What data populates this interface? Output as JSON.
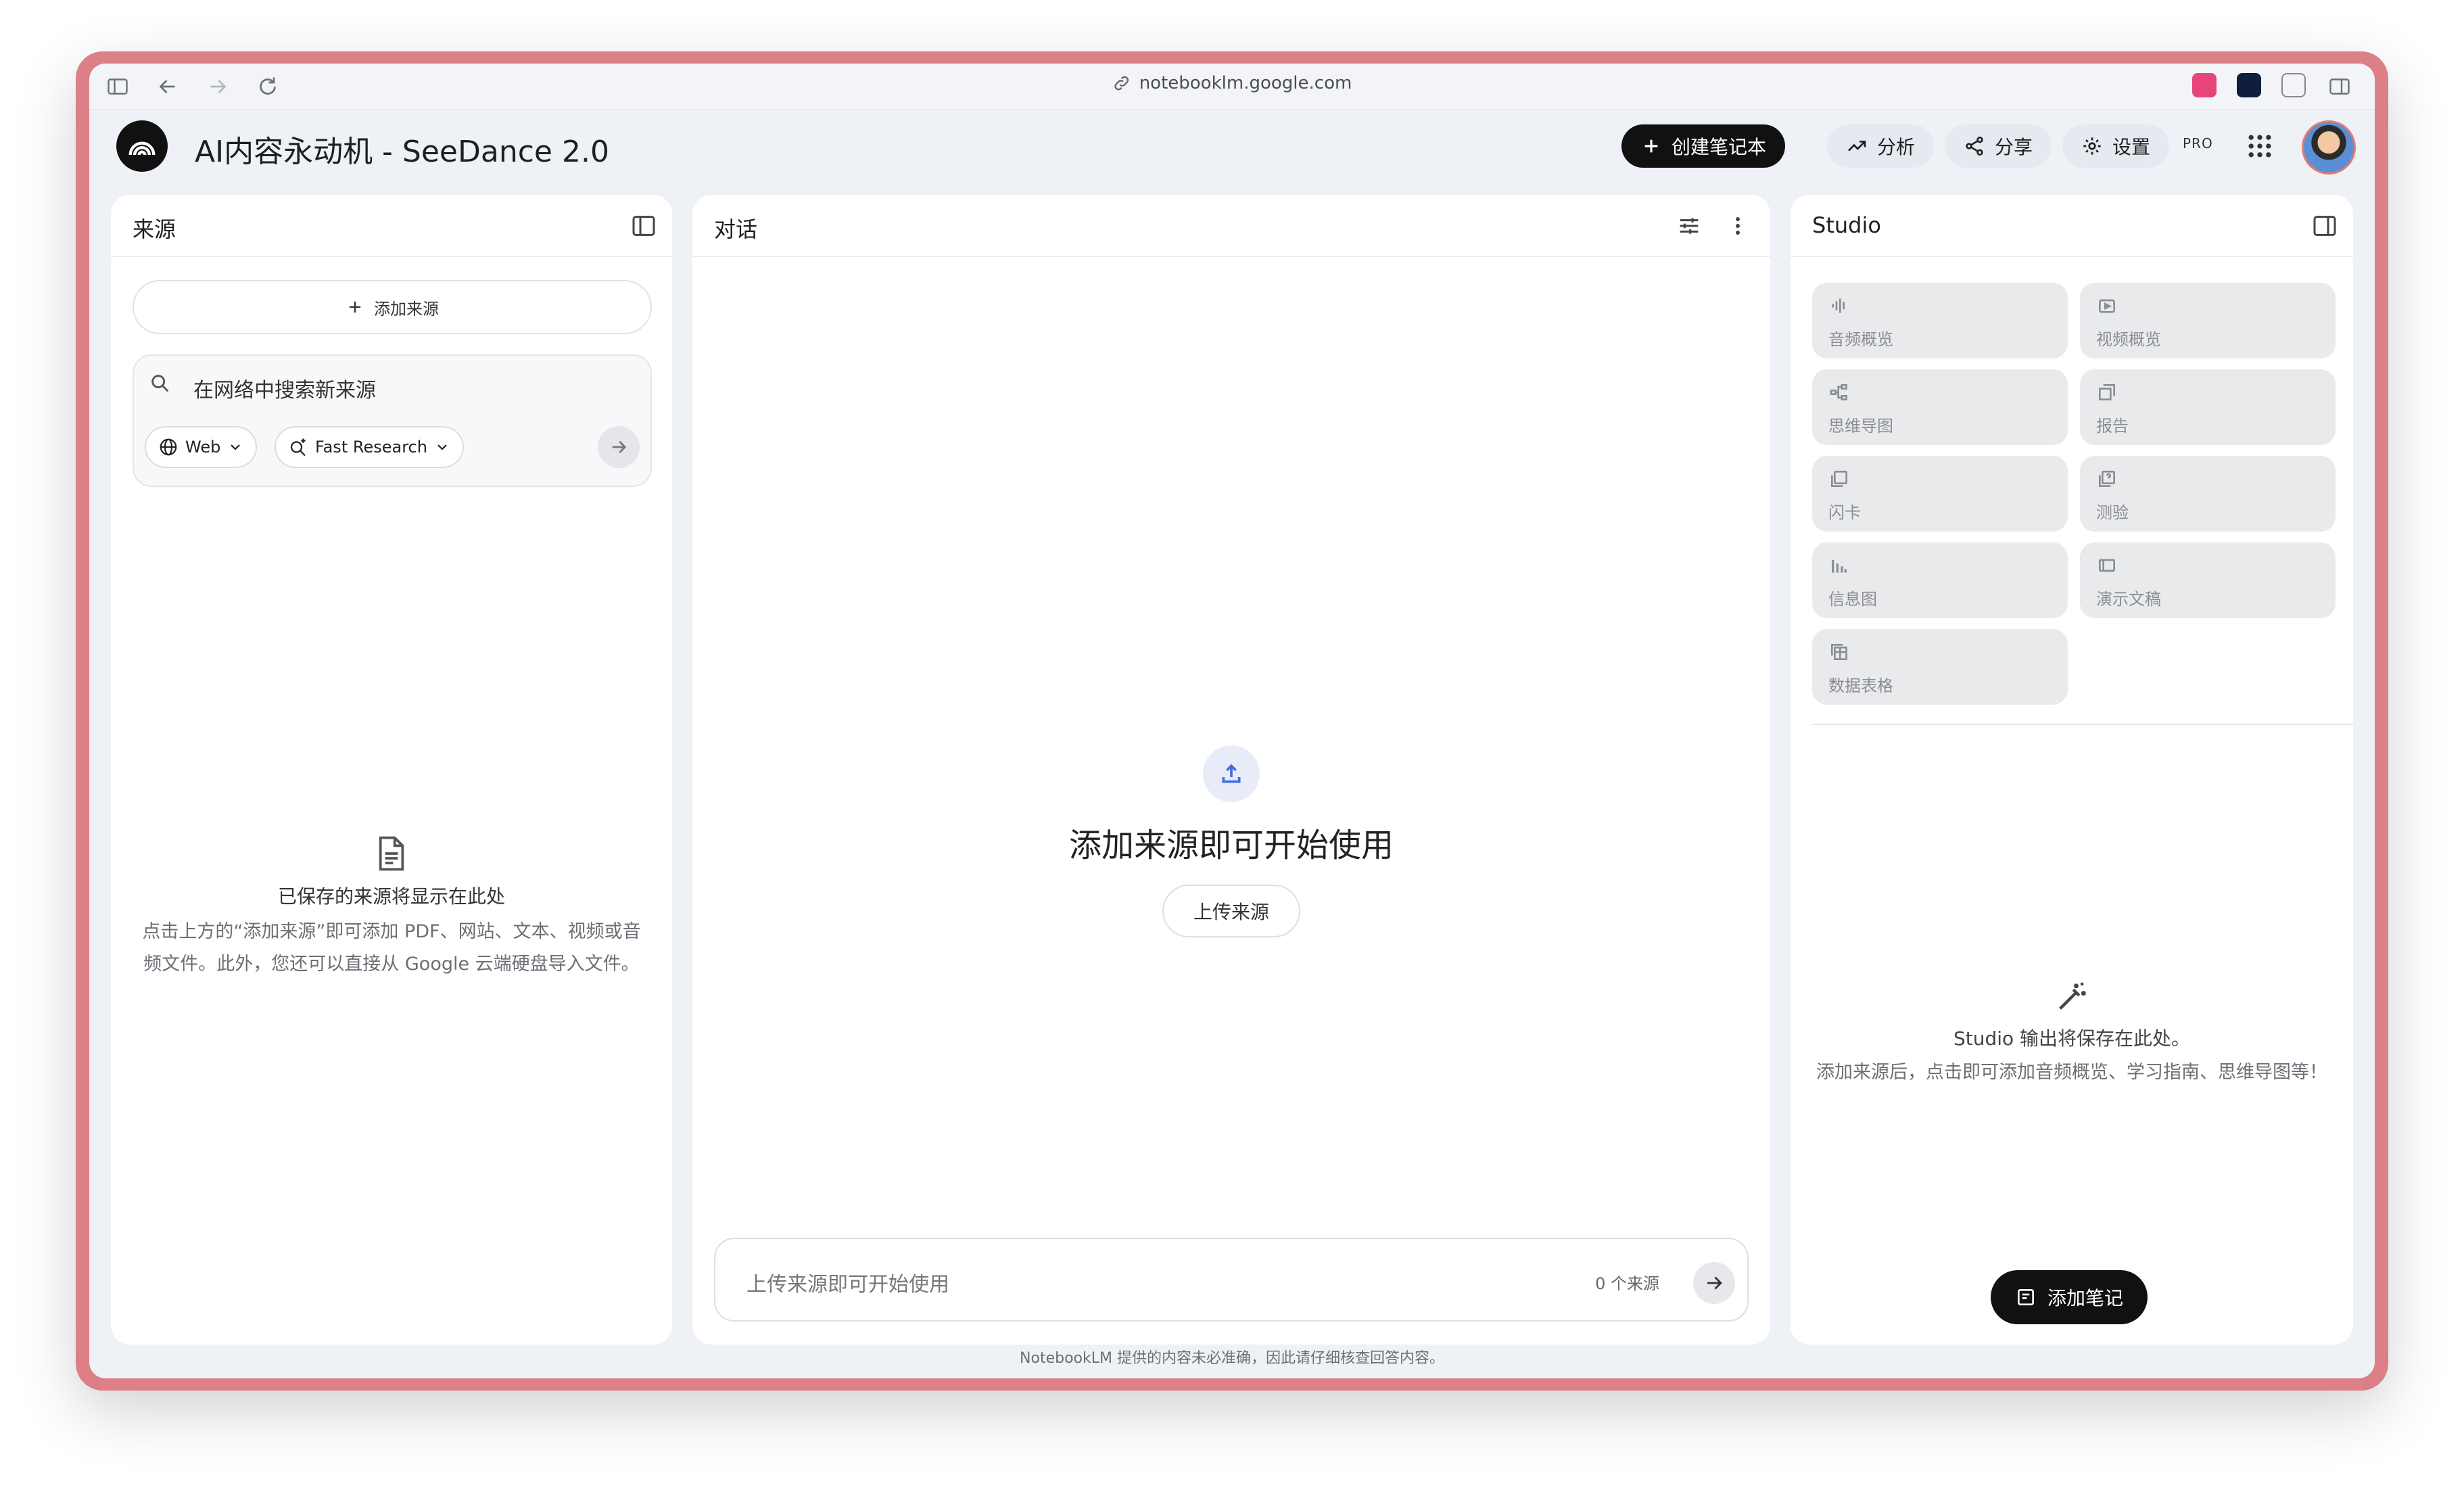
{
  "browser": {
    "url": "notebooklm.google.com"
  },
  "header": {
    "title": "AI内容永动机 - SeeDance 2.0",
    "create_label": "创建笔记本",
    "analytics_label": "分析",
    "share_label": "分享",
    "settings_label": "设置",
    "plan_badge": "PRO"
  },
  "sources": {
    "title": "来源",
    "add_label": "添加来源",
    "search_placeholder": "在网络中搜索新来源",
    "web_chip": "Web",
    "research_chip": "Fast Research",
    "empty_title": "已保存的来源将显示在此处",
    "empty_desc": "点击上方的“添加来源”即可添加 PDF、网站、文本、视频或音频文件。此外，您还可以直接从 Google 云端硬盘导入文件。"
  },
  "chat": {
    "title": "对话",
    "empty_title": "添加来源即可开始使用",
    "upload_label": "上传来源",
    "input_placeholder": "上传来源即可开始使用",
    "source_count": "0 个来源"
  },
  "studio": {
    "title": "Studio",
    "tiles": [
      {
        "label": "音频概览",
        "icon": "audio-waveform-icon"
      },
      {
        "label": "视频概览",
        "icon": "video-icon"
      },
      {
        "label": "思维导图",
        "icon": "mindmap-icon"
      },
      {
        "label": "报告",
        "icon": "report-icon"
      },
      {
        "label": "闪卡",
        "icon": "flashcard-icon"
      },
      {
        "label": "测验",
        "icon": "quiz-icon"
      },
      {
        "label": "信息图",
        "icon": "infographic-icon"
      },
      {
        "label": "演示文稿",
        "icon": "slides-icon"
      },
      {
        "label": "数据表格",
        "icon": "table-icon"
      }
    ],
    "empty_title": "Studio 输出将保存在此处。",
    "empty_desc": "添加来源后，点击即可添加音频概览、学习指南、思维导图等！",
    "add_note_label": "添加笔记"
  },
  "footer": {
    "disclaimer": "NotebookLM 提供的内容未必准确，因此请仔细核查回答内容。"
  },
  "colors": {
    "accent_dark": "#111111",
    "window_frame": "#dd7f86",
    "upload_blue": "#3f6ee0"
  }
}
